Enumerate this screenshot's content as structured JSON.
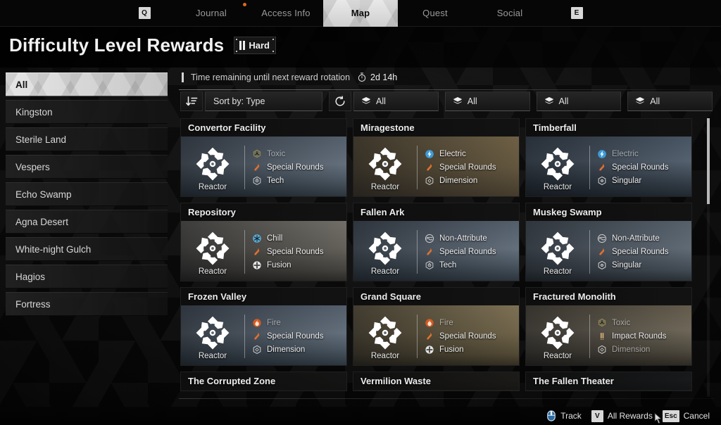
{
  "topnav": {
    "left_key": "Q",
    "right_key": "E",
    "tabs": [
      {
        "label": "Journal",
        "active": false
      },
      {
        "label": "Access Info",
        "active": false
      },
      {
        "label": "Map",
        "active": true
      },
      {
        "label": "Quest",
        "active": false
      },
      {
        "label": "Social",
        "active": false
      }
    ],
    "notification_dot_color": "#e06a18"
  },
  "header": {
    "title": "Difficulty Level Rewards",
    "difficulty": "Hard"
  },
  "sidebar": {
    "items": [
      {
        "label": "All",
        "active": true
      },
      {
        "label": "Kingston",
        "active": false
      },
      {
        "label": "Sterile Land",
        "active": false
      },
      {
        "label": "Vespers",
        "active": false
      },
      {
        "label": "Echo Swamp",
        "active": false
      },
      {
        "label": "Agna Desert",
        "active": false
      },
      {
        "label": "White-night Gulch",
        "active": false
      },
      {
        "label": "Hagios",
        "active": false
      },
      {
        "label": "Fortress",
        "active": false
      }
    ]
  },
  "content": {
    "timer_label": "Time remaining until next reward rotation",
    "timer_value": "2d 14h",
    "toolbar": {
      "sort_label": "Sort by: Type",
      "filters": [
        "All",
        "All",
        "All",
        "All"
      ]
    }
  },
  "cards": [
    {
      "title": "Convertor Facility",
      "reactor_label": "Reactor",
      "art": "snow-ruins",
      "attributes": [
        {
          "name": "Toxic",
          "icon": "toxic-icon",
          "color": "#8d8759",
          "dim": true
        },
        {
          "name": "Special Rounds",
          "icon": "special-rounds-icon",
          "color": "#e0702e",
          "dim": false
        },
        {
          "name": "Tech",
          "icon": "tech-icon",
          "color": "#c9c9c9",
          "dim": false
        }
      ]
    },
    {
      "title": "Miragestone",
      "reactor_label": "Reactor",
      "art": "desert-dunes",
      "attributes": [
        {
          "name": "Electric",
          "icon": "electric-icon",
          "color": "#3d9ad6",
          "dim": false
        },
        {
          "name": "Special Rounds",
          "icon": "special-rounds-icon",
          "color": "#e0702e",
          "dim": false
        },
        {
          "name": "Dimension",
          "icon": "dimension-icon",
          "color": "#cfcfcf",
          "dim": false
        }
      ]
    },
    {
      "title": "Timberfall",
      "reactor_label": "Reactor",
      "art": "blue-forest",
      "attributes": [
        {
          "name": "Electric",
          "icon": "electric-icon",
          "color": "#3d9ad6",
          "dim": true
        },
        {
          "name": "Special Rounds",
          "icon": "special-rounds-icon",
          "color": "#e0702e",
          "dim": false
        },
        {
          "name": "Singular",
          "icon": "singular-icon",
          "color": "#d4d4d4",
          "dim": false
        }
      ]
    },
    {
      "title": "Repository",
      "reactor_label": "Reactor",
      "art": "grey-rubble",
      "attributes": [
        {
          "name": "Chill",
          "icon": "chill-icon",
          "color": "#5fa8cf",
          "dim": false
        },
        {
          "name": "Special Rounds",
          "icon": "special-rounds-icon",
          "color": "#e0702e",
          "dim": false
        },
        {
          "name": "Fusion",
          "icon": "fusion-icon",
          "color": "#e4e4e4",
          "dim": false
        }
      ]
    },
    {
      "title": "Fallen Ark",
      "reactor_label": "Reactor",
      "art": "snow-ruins",
      "attributes": [
        {
          "name": "Non-Attribute",
          "icon": "non-attribute-icon",
          "color": "#cfcfcf",
          "dim": false
        },
        {
          "name": "Special Rounds",
          "icon": "special-rounds-icon",
          "color": "#e0702e",
          "dim": false
        },
        {
          "name": "Tech",
          "icon": "tech-icon",
          "color": "#c9c9c9",
          "dim": false
        }
      ]
    },
    {
      "title": "Muskeg Swamp",
      "reactor_label": "Reactor",
      "art": "swamp-tree",
      "attributes": [
        {
          "name": "Non-Attribute",
          "icon": "non-attribute-icon",
          "color": "#cfcfcf",
          "dim": false
        },
        {
          "name": "Special Rounds",
          "icon": "special-rounds-icon",
          "color": "#e0702e",
          "dim": false
        },
        {
          "name": "Singular",
          "icon": "singular-icon",
          "color": "#d4d4d4",
          "dim": false
        }
      ]
    },
    {
      "title": "Frozen Valley",
      "reactor_label": "Reactor",
      "art": "snow-ruins",
      "attributes": [
        {
          "name": "Fire",
          "icon": "fire-icon",
          "color": "#d35a22",
          "dim": true
        },
        {
          "name": "Special Rounds",
          "icon": "special-rounds-icon",
          "color": "#e0702e",
          "dim": false
        },
        {
          "name": "Dimension",
          "icon": "dimension-icon",
          "color": "#cfcfcf",
          "dim": false
        }
      ]
    },
    {
      "title": "Grand Square",
      "reactor_label": "Reactor",
      "art": "sand-ruins",
      "attributes": [
        {
          "name": "Fire",
          "icon": "fire-icon",
          "color": "#d35a22",
          "dim": true
        },
        {
          "name": "Special Rounds",
          "icon": "special-rounds-icon",
          "color": "#e0702e",
          "dim": false
        },
        {
          "name": "Fusion",
          "icon": "fusion-icon",
          "color": "#e4e4e4",
          "dim": false
        }
      ]
    },
    {
      "title": "Fractured Monolith",
      "reactor_label": "Reactor",
      "art": "monolith",
      "attributes": [
        {
          "name": "Toxic",
          "icon": "toxic-icon",
          "color": "#8d8759",
          "dim": true
        },
        {
          "name": "Impact Rounds",
          "icon": "impact-rounds-icon",
          "color": "#d8b37a",
          "dim": false
        },
        {
          "name": "Dimension",
          "icon": "dimension-icon",
          "color": "#cfcfcf",
          "dim": true
        }
      ]
    }
  ],
  "cards_partial": [
    {
      "title": "The Corrupted Zone",
      "art": "dark-zone"
    },
    {
      "title": "Vermilion Waste",
      "art": "sand-ruins"
    },
    {
      "title": "The Fallen Theater",
      "art": "blue-forest"
    }
  ],
  "bottombar": {
    "hints": [
      {
        "key": "",
        "icon": "mouse-icon",
        "label": "Track"
      },
      {
        "key": "V",
        "icon": "",
        "label": "All Rewards"
      },
      {
        "key": "Esc",
        "icon": "",
        "label": "Cancel"
      }
    ]
  }
}
